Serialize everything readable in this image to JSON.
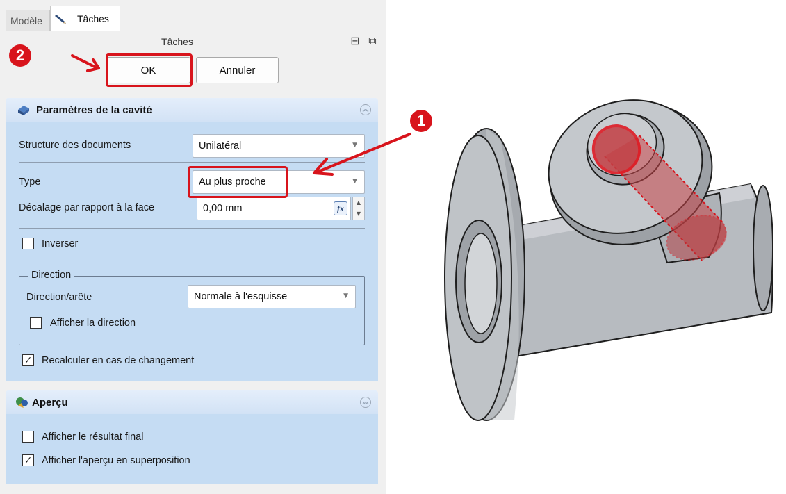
{
  "tabs": {
    "model": "Modèle",
    "tasks": "Tâches"
  },
  "header": {
    "title": "Tâches",
    "restore_icon": "window-restore-icon",
    "float_icon": "float-icon"
  },
  "buttons": {
    "ok": "OK",
    "cancel": "Annuler"
  },
  "panel1": {
    "title": "Paramètres de la cavité",
    "icon": "pocket-icon",
    "doc_structure_label": "Structure des documents",
    "doc_structure_value": "Unilatéral",
    "type_label": "Type",
    "type_value": "Au plus proche",
    "offset_label": "Décalage par rapport à la face",
    "offset_value": "0,00 mm",
    "fx_label": "fx",
    "reverse_label": "Inverser",
    "reverse_checked": false,
    "direction_group": "Direction",
    "direction_edge_label": "Direction/arête",
    "direction_edge_value": "Normale à l'esquisse",
    "show_direction_label": "Afficher la direction",
    "show_direction_checked": false,
    "recalc_label": "Recalculer en cas de changement",
    "recalc_checked": true
  },
  "panel2": {
    "title": "Aperçu",
    "icon": "preview-icon",
    "final_label": "Afficher le résultat final",
    "final_checked": false,
    "overlay_label": "Afficher l'aperçu en superposition",
    "overlay_checked": true
  },
  "annotations": {
    "step1": "1",
    "step2": "2",
    "color": "#d8141c"
  },
  "colors": {
    "panel_body": "#c5dcf3",
    "pipe_gray": "#c4c8cc"
  }
}
